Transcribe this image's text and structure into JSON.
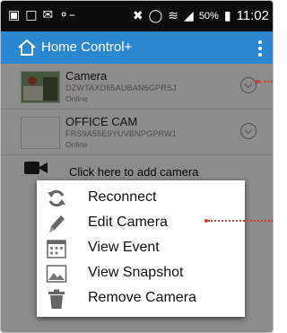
{
  "status_bar": {
    "percent": "50%",
    "time": "11:02"
  },
  "app_bar": {
    "title": "Home Control+"
  },
  "cameras": [
    {
      "name": "Camera",
      "id": "DZWTAXD65AUBAN6GPRSJ",
      "status": "Online"
    },
    {
      "name": "OFFICE CAM",
      "id": "FRS9A55E9YUVBNPGPRW1",
      "status": "Online"
    }
  ],
  "add_camera_label": "Click here to add camera",
  "context_menu": {
    "items": [
      {
        "label": "Reconnect",
        "icon": "refresh-icon"
      },
      {
        "label": "Edit Camera",
        "icon": "pencil-icon"
      },
      {
        "label": "View Event",
        "icon": "calendar-icon"
      },
      {
        "label": "View Snapshot",
        "icon": "image-icon"
      },
      {
        "label": "Remove Camera",
        "icon": "trash-icon"
      }
    ]
  },
  "colors": {
    "app_bar": "#2b87cf",
    "annotation": "#d33a3a"
  }
}
